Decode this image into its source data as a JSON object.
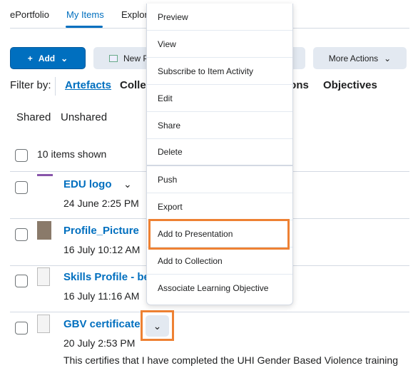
{
  "tabs": [
    {
      "label": "ePortfolio"
    },
    {
      "label": "My Items"
    },
    {
      "label": "Explore"
    }
  ],
  "toolbar": {
    "add": "Add",
    "new_presentation": "New Presentation",
    "more_actions": "More Actions"
  },
  "filter": {
    "label": "Filter by:",
    "options": [
      "Artefacts",
      "Collections",
      "Reflections",
      "Objectives"
    ],
    "active": "Artefacts"
  },
  "share_tabs": [
    "Shared",
    "Unshared"
  ],
  "list": {
    "count": "10 items shown",
    "items": [
      {
        "title": "EDU logo",
        "date": "24 June 2:25 PM"
      },
      {
        "title": "Profile_Picture",
        "date": "16 July 10:12 AM"
      },
      {
        "title": "Skills Profile - beginning",
        "date": "16 July 11:16 AM"
      },
      {
        "title": "GBV certificate",
        "date": "20 July 2:53 PM",
        "description": "This certifies that I have completed the UHI Gender Based Violence training"
      }
    ]
  },
  "menu": [
    "Preview",
    "View",
    "Subscribe to Item Activity",
    "Edit",
    "Share",
    "Delete",
    "Push",
    "Export",
    "Add to Presentation",
    "Add to Collection",
    "Associate Learning Objective"
  ],
  "colors": {
    "accent": "#006fbf",
    "highlight": "#ee8133"
  }
}
